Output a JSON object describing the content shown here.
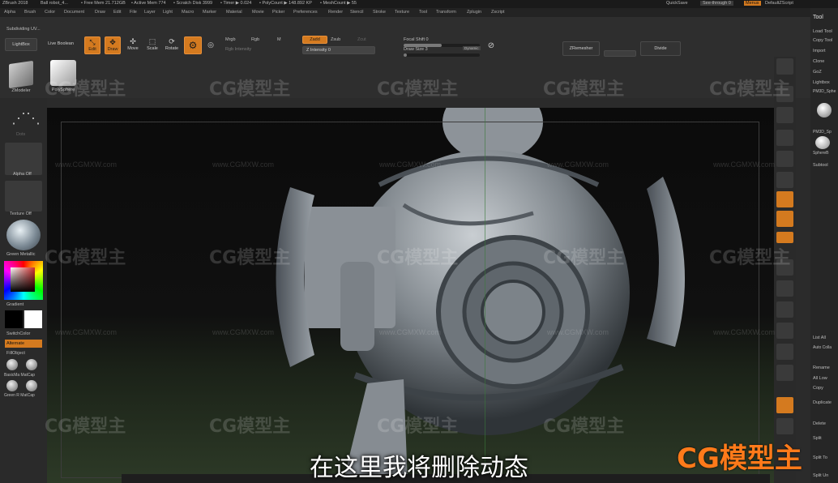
{
  "titlebar": {
    "app": "ZBrush 2018",
    "items": [
      "Ball robot_4...",
      "• Free Mem 21.712GB",
      "• Active Mem 774",
      "• Scratch Disk 3999",
      "• Timer ▶ 0.024",
      "• PolyCount ▶ 148.892 KP",
      "• MeshCount ▶ 55"
    ],
    "quicksave": "QuickSave",
    "see_through": "See-through  0",
    "menus_btn": "Menus",
    "script": "DefaultZScript"
  },
  "menubar": [
    "Alpha",
    "Brush",
    "Color",
    "Document",
    "Draw",
    "Edit",
    "File",
    "Layer",
    "Light",
    "Macro",
    "Marker",
    "Material",
    "Movie",
    "Picker",
    "Preferences",
    "Render",
    "Stencil",
    "Stroke",
    "Texture",
    "Tool",
    "Transform",
    "Zplugin",
    "Zscript"
  ],
  "topshelf": {
    "subtitle_left": "Subdividing UV...",
    "lightbox": "LightBox",
    "live_boolean": "Live Boolean",
    "edit": "Edit",
    "draw": "Draw",
    "move": "Move",
    "scale": "Scale",
    "rotate": "Rotate",
    "mrgb": "Mrgb",
    "rgb": "Rgb",
    "m": "M",
    "rgb_intensity": "Rgb Intensity",
    "zadd": "Zadd",
    "zsub": "Zsub",
    "zcut": "Zcut",
    "z_intensity": "Z Intensity 0",
    "focal_shift": "Focal Shift 0",
    "draw_size": "Draw Size 3",
    "dynamic": "Dynamic",
    "zremesher": "ZRemesher",
    "divide": "Divide"
  },
  "leftshelf": {
    "zmodeler": "ZModeler",
    "polysphere": "PolySphere",
    "dots": "Dots",
    "alpha_off": "Alpha Off",
    "texture_off": "Texture Off",
    "material": "Green Metallic",
    "gradient": "Gradient",
    "switchcolor": "SwitchColor",
    "alternate": "Alternate",
    "fillobject": "FillObject",
    "matcap1": "BasicMa MatCap",
    "matcap2": "Green R MatCap"
  },
  "rightshelf": [
    "Bpr",
    "Scroll",
    "Zoom",
    "Actual",
    "AAHalf",
    "Persp",
    "Floor",
    "Local",
    "L.Sym",
    "Xyz",
    "Frame",
    "Move",
    "Scale",
    "Rotate",
    "Line Fill",
    "PolyF",
    "Transp",
    "Ghost",
    "Solo",
    "Xpose"
  ],
  "rightpanel": {
    "title": "Tool",
    "items": [
      "Load Tool",
      "Copy Tool",
      "Import",
      "Clone",
      "GoZ",
      "Lightbox",
      "PM3D_Sphe",
      "PM3D_Sp",
      "SphereB",
      "Subtool",
      "List All",
      "Auto Colla",
      "Rename",
      "All Low",
      "Copy",
      "Duplicate",
      "Delete",
      "Split",
      "Split To",
      "Split Un"
    ]
  },
  "watermark": {
    "text": "CG模型主",
    "url": "www.CGMXW.com"
  },
  "subtitle": "在这里我将删除动态",
  "corner_logo": "CG模型主"
}
